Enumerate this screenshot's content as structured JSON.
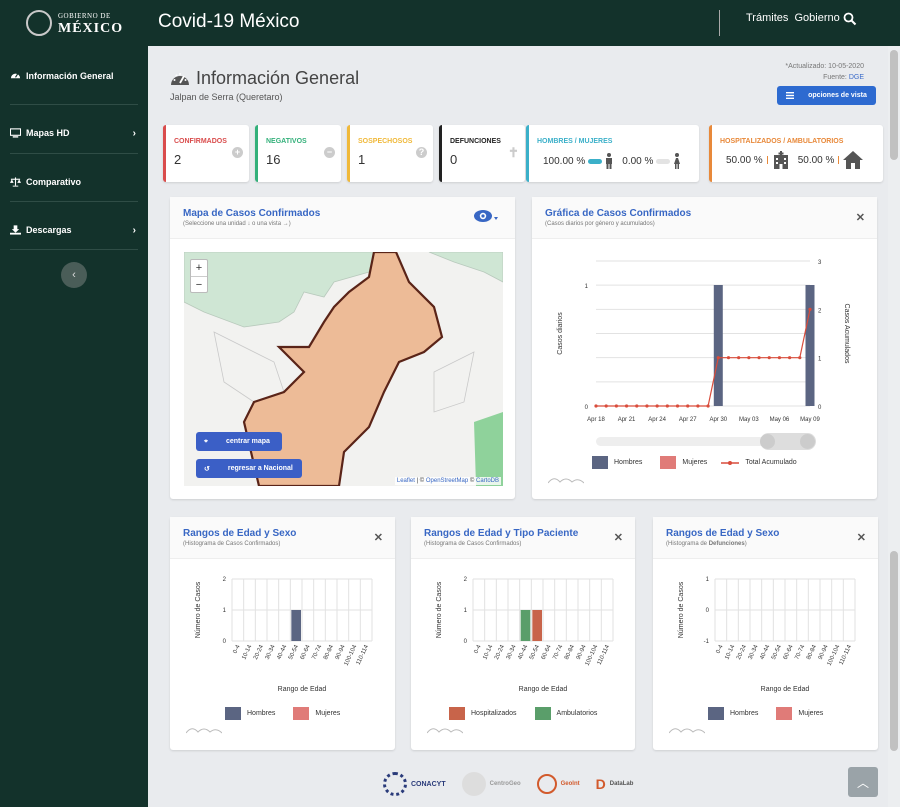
{
  "header": {
    "logo_line1": "GOBIERNO DE",
    "logo_line2": "MÉXICO",
    "app_title": "Covid-19 México",
    "link_tramites": "Trámites",
    "link_gobierno": "Gobierno"
  },
  "sidebar": {
    "items": [
      {
        "label": "Información General"
      },
      {
        "label": "Mapas HD"
      },
      {
        "label": "Comparativo"
      },
      {
        "label": "Descargas"
      }
    ]
  },
  "page": {
    "title": "Información General",
    "subtitle": "Jalpan de Serra (Queretaro)",
    "updated": "*Actualizado: 10-05-2020",
    "source_label": "Fuente:",
    "source_value": "DGE",
    "view_button": "opciones de vista"
  },
  "kpis": {
    "confirmados": {
      "label": "CONFIRMADOS",
      "value": "2",
      "color": "#d94c4c"
    },
    "negativos": {
      "label": "NEGATIVOS",
      "value": "16",
      "color": "#33b07a"
    },
    "sospechosos": {
      "label": "SOSPECHOSOS",
      "value": "1",
      "color": "#f0b93a"
    },
    "defunciones": {
      "label": "DEFUNCIONES",
      "value": "0",
      "color": "#222222"
    },
    "genero": {
      "label": "HOMBRES / MUJERES",
      "hombres": "100.00 %",
      "mujeres": "0.00 %",
      "color": "#3bb0c9"
    },
    "hosp": {
      "label": "HOSPITALIZADOS / AMBULATORIOS",
      "hosp": "50.00 %",
      "amb": "50.00 %",
      "color": "#e8893a"
    }
  },
  "map_panel": {
    "title": "Mapa de Casos Confirmados",
    "subtitle": "(Seleccione una unidad ↓ o una vista →)",
    "zoom_in": "+",
    "zoom_out": "−",
    "center_btn": "centrar mapa",
    "region_btn": "regresar a Nacional",
    "attribution_leaflet": "Leaflet",
    "attribution_sep": " | © ",
    "attribution_osm": "OpenStreetMap",
    "attribution_carto": "CartoDB"
  },
  "cases_chart": {
    "title": "Gráfica de Casos Confirmados",
    "subtitle": "(Casos diarios por género y acumulados)",
    "legend_hombres": "Hombres",
    "legend_mujeres": "Mujeres",
    "legend_total": "Total Acumulado"
  },
  "hist1": {
    "title": "Rangos de Edad y Sexo",
    "subtitle": "(Histograma de Casos Confirmados)",
    "legend_a": "Hombres",
    "legend_b": "Mujeres"
  },
  "hist2": {
    "title": "Rangos de Edad y Tipo Paciente",
    "subtitle": "(Histograma de Casos Confirmados)",
    "legend_a": "Hospitalizados",
    "legend_b": "Ambulatorios"
  },
  "hist3": {
    "title": "Rangos de Edad y Sexo",
    "subtitle_pre": "(Histograma de ",
    "subtitle_bold": "Defunciones",
    "subtitle_post": ")",
    "legend_a": "Hombres",
    "legend_b": "Mujeres"
  },
  "footer": {
    "logo1": "CONACYT",
    "logo2": "CentroGeo",
    "logo3": "GeoInt",
    "logo4": "DataLab"
  },
  "colors": {
    "brand": "#13322b",
    "hombres": "#5b6582",
    "mujeres": "#e07b78",
    "total": "#d94c3b",
    "hosp": "#c8644a",
    "amb": "#5a9e6a",
    "accent": "#3867c4"
  },
  "chart_data": [
    {
      "type": "bar",
      "title": "Gráfica de Casos Confirmados",
      "ylabel": "Casos diarios",
      "y2label": "Casos Acumulados",
      "x": [
        "Apr 18",
        "Apr 19",
        "Apr 20",
        "Apr 21",
        "Apr 22",
        "Apr 23",
        "Apr 24",
        "Apr 25",
        "Apr 26",
        "Apr 27",
        "Apr 28",
        "Apr 29",
        "Apr 30",
        "May 01",
        "May 02",
        "May 03",
        "May 04",
        "May 05",
        "May 06",
        "May 07",
        "May 08",
        "May 09"
      ],
      "x_ticks": [
        "Apr 18",
        "Apr 21",
        "Apr 24",
        "Apr 27",
        "Apr 30",
        "May 03",
        "May 06",
        "May 09"
      ],
      "ylim": [
        0,
        1
      ],
      "y2lim": [
        0,
        3
      ],
      "y_ticks": [
        "0",
        "1"
      ],
      "y2_ticks": [
        "0",
        "1",
        "2",
        "3"
      ],
      "series": [
        {
          "name": "Hombres",
          "values": [
            0,
            0,
            0,
            0,
            0,
            0,
            0,
            0,
            0,
            0,
            0,
            0,
            1,
            0,
            0,
            0,
            0,
            0,
            0,
            0,
            0,
            1
          ]
        },
        {
          "name": "Mujeres",
          "values": [
            0,
            0,
            0,
            0,
            0,
            0,
            0,
            0,
            0,
            0,
            0,
            0,
            0,
            0,
            0,
            0,
            0,
            0,
            0,
            0,
            0,
            0
          ]
        },
        {
          "name": "Total Acumulado",
          "values": [
            0,
            0,
            0,
            0,
            0,
            0,
            0,
            0,
            0,
            0,
            0,
            0,
            1,
            1,
            1,
            1,
            1,
            1,
            1,
            1,
            1,
            2
          ]
        }
      ]
    },
    {
      "type": "bar",
      "title": "Rangos de Edad y Sexo",
      "xlabel": "Rango de Edad",
      "ylabel": "Número de Casos",
      "categories": [
        "0-4",
        "10-14",
        "20-24",
        "30-34",
        "40-44",
        "50-54",
        "60-64",
        "70-74",
        "80-84",
        "90-94",
        "100-104",
        "110-114"
      ],
      "ylim": [
        0,
        2
      ],
      "y_ticks": [
        "0",
        "1",
        "2"
      ],
      "series": [
        {
          "name": "Hombres",
          "values": [
            0,
            0,
            0,
            0,
            0,
            1,
            0,
            0,
            0,
            0,
            0,
            0
          ]
        },
        {
          "name": "Mujeres",
          "values": [
            0,
            0,
            0,
            0,
            0,
            0,
            0,
            0,
            0,
            0,
            0,
            0
          ]
        }
      ]
    },
    {
      "type": "bar",
      "title": "Rangos de Edad y Tipo Paciente",
      "xlabel": "Rango de Edad",
      "ylabel": "Número de Casos",
      "categories": [
        "0-4",
        "10-14",
        "20-24",
        "30-34",
        "40-44",
        "50-54",
        "60-64",
        "70-74",
        "80-84",
        "90-94",
        "100-104",
        "110-114"
      ],
      "ylim": [
        0,
        2
      ],
      "y_ticks": [
        "0",
        "1",
        "2"
      ],
      "series": [
        {
          "name": "Hospitalizados",
          "values": [
            0,
            0,
            0,
            0,
            0,
            1,
            0,
            0,
            0,
            0,
            0,
            0
          ]
        },
        {
          "name": "Ambulatorios",
          "values": [
            0,
            0,
            0,
            0,
            1,
            0,
            0,
            0,
            0,
            0,
            0,
            0
          ]
        }
      ]
    },
    {
      "type": "bar",
      "title": "Rangos de Edad y Sexo",
      "xlabel": "Rango de Edad",
      "ylabel": "Número de Casos",
      "categories": [
        "0-4",
        "10-14",
        "20-24",
        "30-34",
        "40-44",
        "50-54",
        "60-64",
        "70-74",
        "80-84",
        "90-94",
        "100-104",
        "110-114"
      ],
      "ylim": [
        -1,
        1
      ],
      "y_ticks": [
        "-1",
        "0",
        "1"
      ],
      "series": [
        {
          "name": "Hombres",
          "values": [
            0,
            0,
            0,
            0,
            0,
            0,
            0,
            0,
            0,
            0,
            0,
            0
          ]
        },
        {
          "name": "Mujeres",
          "values": [
            0,
            0,
            0,
            0,
            0,
            0,
            0,
            0,
            0,
            0,
            0,
            0
          ]
        }
      ]
    }
  ]
}
